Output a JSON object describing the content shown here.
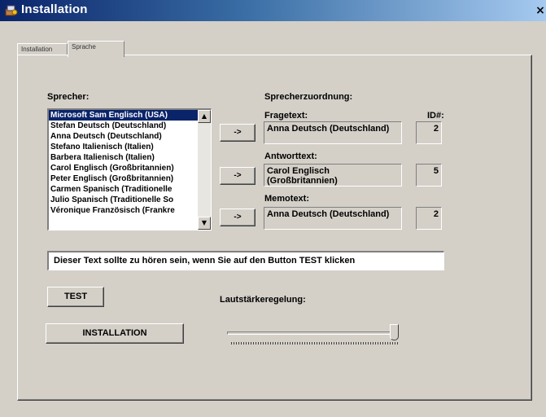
{
  "window": {
    "title": "Installation",
    "close_glyph": "×"
  },
  "tabs": [
    {
      "label": "Installation",
      "active": false
    },
    {
      "label": "Sprache",
      "active": true
    }
  ],
  "speakers": {
    "label": "Sprecher:",
    "items": [
      "Microsoft Sam Englisch (USA)",
      "Stefan Deutsch (Deutschland)",
      "Anna Deutsch (Deutschland)",
      "Stefano Italienisch (Italien)",
      "Barbera Italienisch (Italien)",
      "Carol Englisch (Großbritannien)",
      "Peter Englisch (Großbritannien)",
      "Carmen Spanisch (Traditionelle",
      "Julio Spanisch (Traditionelle So",
      "Véronique Französisch (Frankre"
    ],
    "selected_index": 0
  },
  "assignment": {
    "label": "Sprecherzuordnung:",
    "id_label": "ID#:",
    "arrow_label": "->",
    "rows": [
      {
        "label": "Fragetext:",
        "value": "Anna Deutsch (Deutschland)",
        "id": "2"
      },
      {
        "label": "Antworttext:",
        "value": "Carol Englisch (Großbritannien)",
        "id": "5"
      },
      {
        "label": "Memotext:",
        "value": "Anna Deutsch (Deutschland)",
        "id": "2"
      }
    ]
  },
  "test_text": "Dieser Text sollte zu hören sein, wenn Sie auf den Button TEST klicken",
  "buttons": {
    "test": "TEST",
    "install": "INSTALLATION"
  },
  "volume": {
    "label": "Lautstärkeregelung:",
    "level": 0.98
  },
  "colors": {
    "title_start": "#0a246a",
    "title_end": "#a6caf0",
    "selection": "#0a246a",
    "face": "#d4d0c8"
  },
  "icons": {
    "app": "setup-icon",
    "close": "close-icon",
    "scroll_up": "triangle-up-icon",
    "scroll_down": "triangle-down-icon"
  }
}
